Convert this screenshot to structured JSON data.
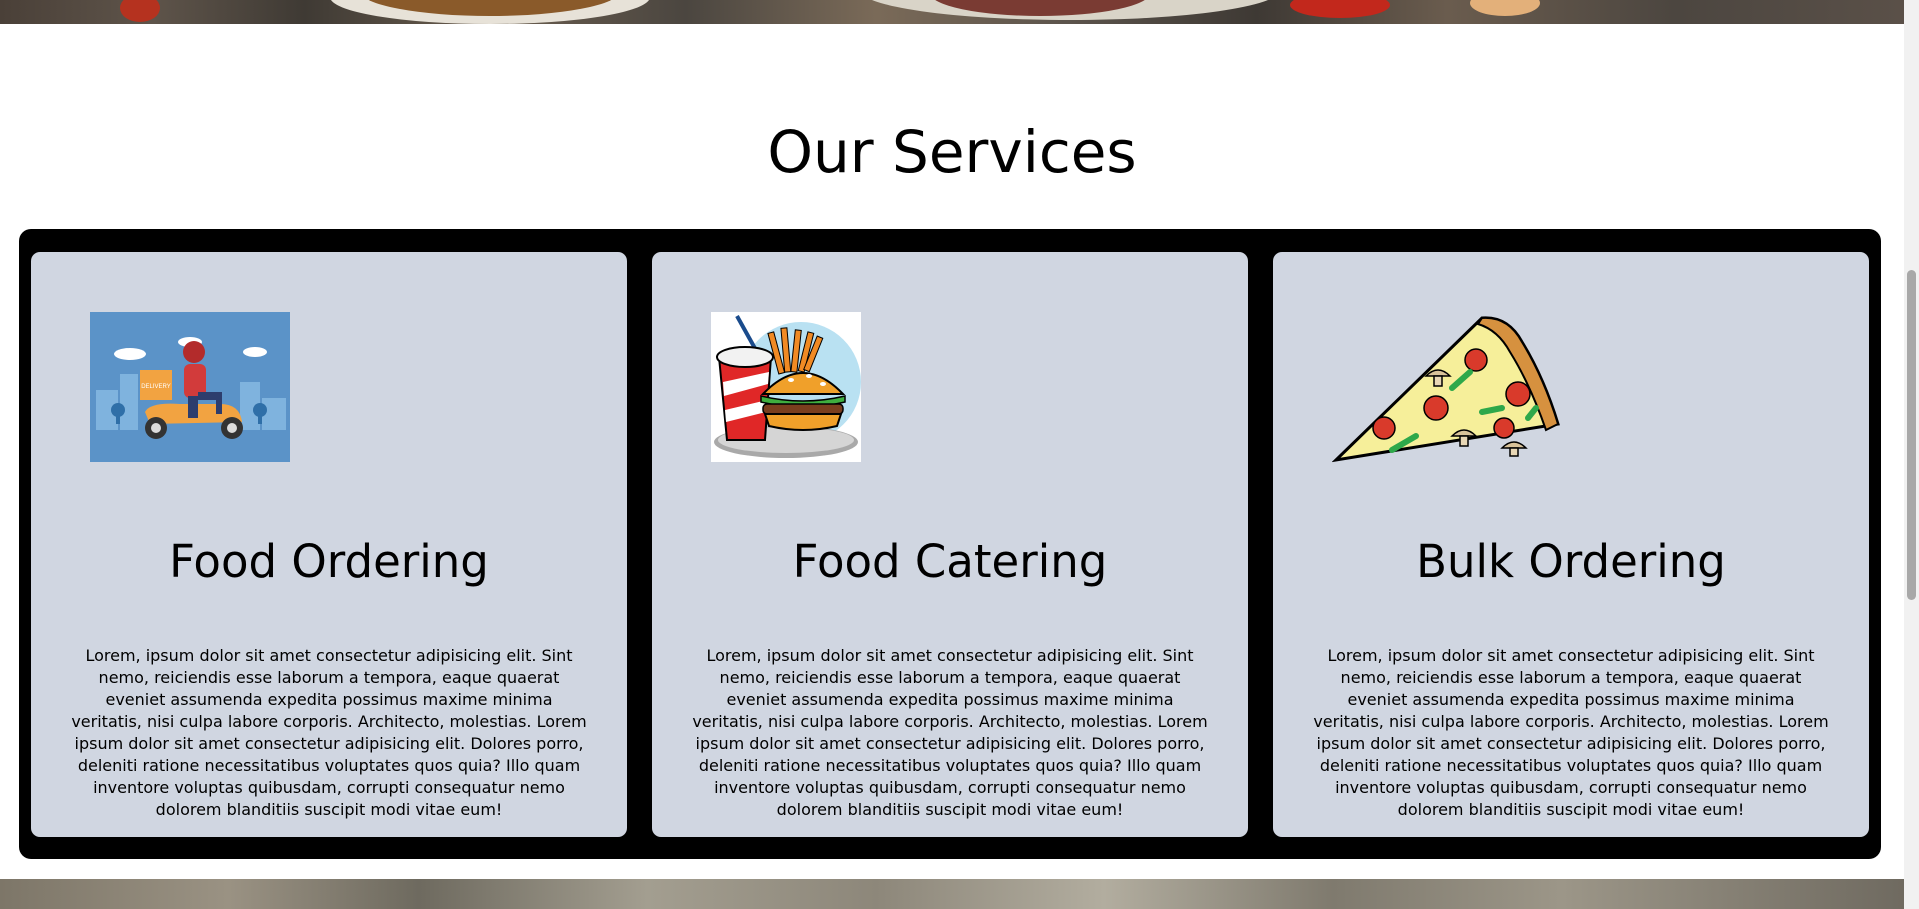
{
  "services": {
    "title": "Our Services",
    "cards": [
      {
        "title": "Food Ordering",
        "icon": "delivery-scooter-icon",
        "text": "Lorem, ipsum dolor sit amet consectetur adipisicing elit. Sint nemo, reiciendis esse laborum a tempora, eaque quaerat eveniet assumenda expedita possimus maxime minima veritatis, nisi culpa labore corporis. Architecto, molestias. Lorem ipsum dolor sit amet consectetur adipisicing elit. Dolores porro, deleniti ratione necessitatibus voluptates quos quia? Illo quam inventore voluptas quibusdam, corrupti consequatur nemo dolorem blanditiis suscipit modi vitae eum!"
      },
      {
        "title": "Food Catering",
        "icon": "fast-food-icon",
        "text": "Lorem, ipsum dolor sit amet consectetur adipisicing elit. Sint nemo, reiciendis esse laborum a tempora, eaque quaerat eveniet assumenda expedita possimus maxime minima veritatis, nisi culpa labore corporis. Architecto, molestias. Lorem ipsum dolor sit amet consectetur adipisicing elit. Dolores porro, deleniti ratione necessitatibus voluptates quos quia? Illo quam inventore voluptas quibusdam, corrupti consequatur nemo dolorem blanditiis suscipit modi vitae eum!"
      },
      {
        "title": "Bulk Ordering",
        "icon": "pizza-slice-icon",
        "text": "Lorem, ipsum dolor sit amet consectetur adipisicing elit. Sint nemo, reiciendis esse laborum a tempora, eaque quaerat eveniet assumenda expedita possimus maxime minima veritatis, nisi culpa labore corporis. Architecto, molestias. Lorem ipsum dolor sit amet consectetur adipisicing elit. Dolores porro, deleniti ratione necessitatibus voluptates quos quia? Illo quam inventore voluptas quibusdam, corrupti consequatur nemo dolorem blanditiis suscipit modi vitae eum!"
      }
    ]
  },
  "delivery_badge": "DELIVERY",
  "colors": {
    "card_background": "#d0d6e1",
    "frame_background": "#000000",
    "page_background": "#ffffff"
  }
}
